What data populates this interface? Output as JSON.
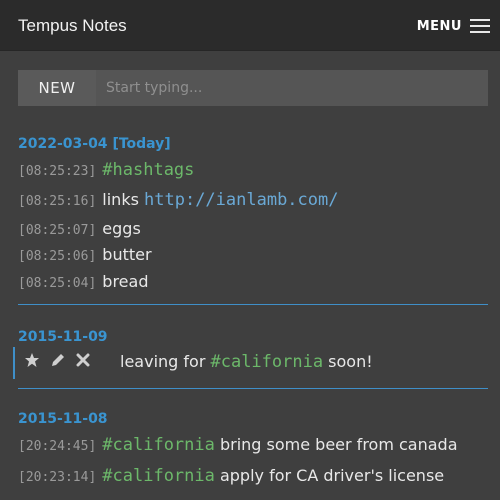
{
  "app": {
    "title": "Tempus Notes",
    "menu_label": "MENU"
  },
  "entry": {
    "new_label": "NEW",
    "placeholder": "Start typing..."
  },
  "days": [
    {
      "date": "2022-03-04",
      "today_label": "[Today]",
      "notes": [
        {
          "time": "[08:25:23]",
          "tag": "#hashtags",
          "text": ""
        },
        {
          "time": "[08:25:16]",
          "text": "links",
          "link": "http://ianlamb.com/"
        },
        {
          "time": "[08:25:07]",
          "text": "eggs"
        },
        {
          "time": "[08:25:06]",
          "text": "butter"
        },
        {
          "time": "[08:25:04]",
          "text": "bread"
        }
      ]
    },
    {
      "date": "2015-11-09",
      "notes": [
        {
          "text_before": "leaving for",
          "tag": "#california",
          "text_after": "soon!"
        }
      ]
    },
    {
      "date": "2015-11-08",
      "notes": [
        {
          "time": "[20:24:45]",
          "tag": "#california",
          "text": "bring some beer from canada"
        },
        {
          "time": "[20:23:14]",
          "tag": "#california",
          "text": "apply for CA driver's license"
        }
      ]
    }
  ],
  "icons": [
    "star-icon",
    "edit-pencil-icon",
    "delete-x-icon",
    "hamburger-menu-icon"
  ],
  "colors": {
    "accent": "#3a94d0",
    "tag": "#6cb86a",
    "link": "#6aa9d6",
    "background": "#3f3f3f",
    "header": "#2b2b2b"
  }
}
